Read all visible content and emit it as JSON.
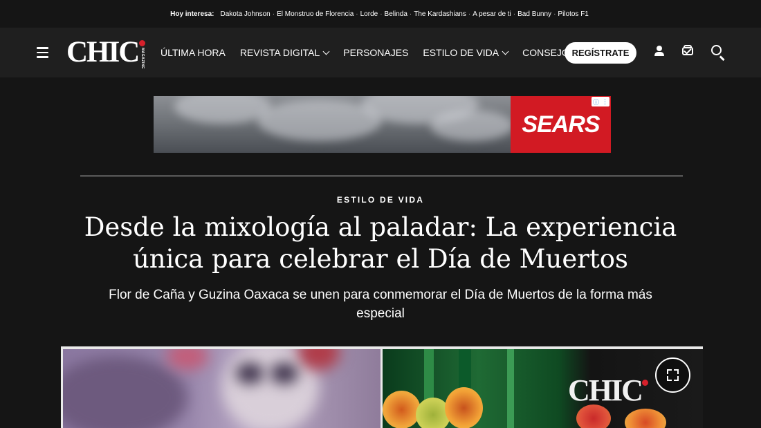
{
  "trending": {
    "label": "Hoy interesa:",
    "topics": [
      "Dakota Johnson",
      "El Monstruo de Florencia",
      "Lorde",
      "Belinda",
      "The Kardashians",
      "A pesar de ti",
      "Bad Bunny",
      "Pilotos F1"
    ]
  },
  "header": {
    "logo_text": "CHIC",
    "logo_sub": "MAGAZINE",
    "menu": [
      {
        "label": "ÚLTIMA HORA",
        "dropdown": false
      },
      {
        "label": "REVISTA DIGITAL",
        "dropdown": true
      },
      {
        "label": "PERSONAJES",
        "dropdown": false
      },
      {
        "label": "ESTILO DE VIDA",
        "dropdown": true
      },
      {
        "label": "CONSEJOS",
        "dropdown": false
      }
    ],
    "register_label": "REGÍSTRATE",
    "icons": [
      "hamburger-menu-icon",
      "user-icon",
      "magazine-icon",
      "search-icon"
    ]
  },
  "ad": {
    "brand": "SEARS",
    "brand_color": "#d21a23"
  },
  "article": {
    "kicker": "ESTILO DE VIDA",
    "title": "Desde la mixología al paladar: La experiencia única para celebrar el Día de Muertos",
    "subtitle": "Flor de Caña y Guzina Oaxaca se unen para conmemorar el Día de Muertos de la forma más especial",
    "image_watermark": "CHIC"
  },
  "colors": {
    "background": "#151515",
    "nav_background": "#1f1f1f",
    "accent": "#d6202b"
  }
}
